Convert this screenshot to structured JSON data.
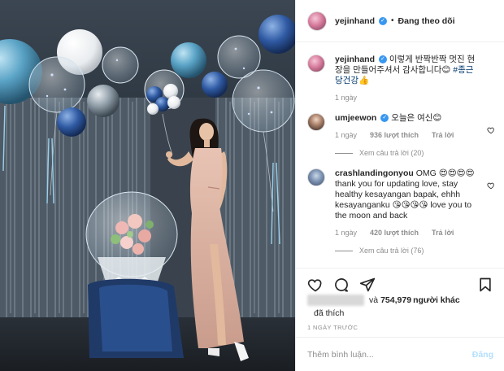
{
  "post": {
    "username": "yejinhand",
    "follow_status": "Đang theo dõi",
    "caption": {
      "username": "yejinhand",
      "text": "이렇게 반짝반짝 멋진 현장을 만들어주셔서 감사합니다😊",
      "hashtag": "#종근당건강",
      "emoji": "👍",
      "time": "1 ngày"
    },
    "comments": [
      {
        "username": "umjeewon",
        "text": "오늘은 여신😊",
        "time": "1 ngày",
        "likes": "936 lượt thích",
        "reply": "Trả lời",
        "view_replies": "Xem câu trả lời (20)"
      },
      {
        "username": "crashlandingonyou",
        "text": "OMG 😍😍😍😍 thank you for updating love, stay healthy kesayangan bapak, ehhh kesayanganku 😘😘😘😘 love you to the moon and back",
        "time": "1 ngày",
        "likes": "420 lượt thích",
        "reply": "Trả lời",
        "view_replies": "Xem câu trả lời (76)"
      }
    ],
    "likes": {
      "and": "và",
      "count": "754,979",
      "suffix": "người khác",
      "liked": "đã thích"
    },
    "date": "1 NGÀY TRƯỚC",
    "add_comment": {
      "placeholder": "Thêm bình luận...",
      "post_label": "Đăng"
    }
  },
  "colors": {
    "verified": "#3897f0",
    "post_disabled": "#b2dffc",
    "hashtag": "#00376b",
    "muted": "#8e8e8e"
  },
  "icons": [
    "verified-badge-icon",
    "heart-icon",
    "comment-icon",
    "share-icon",
    "bookmark-icon"
  ]
}
